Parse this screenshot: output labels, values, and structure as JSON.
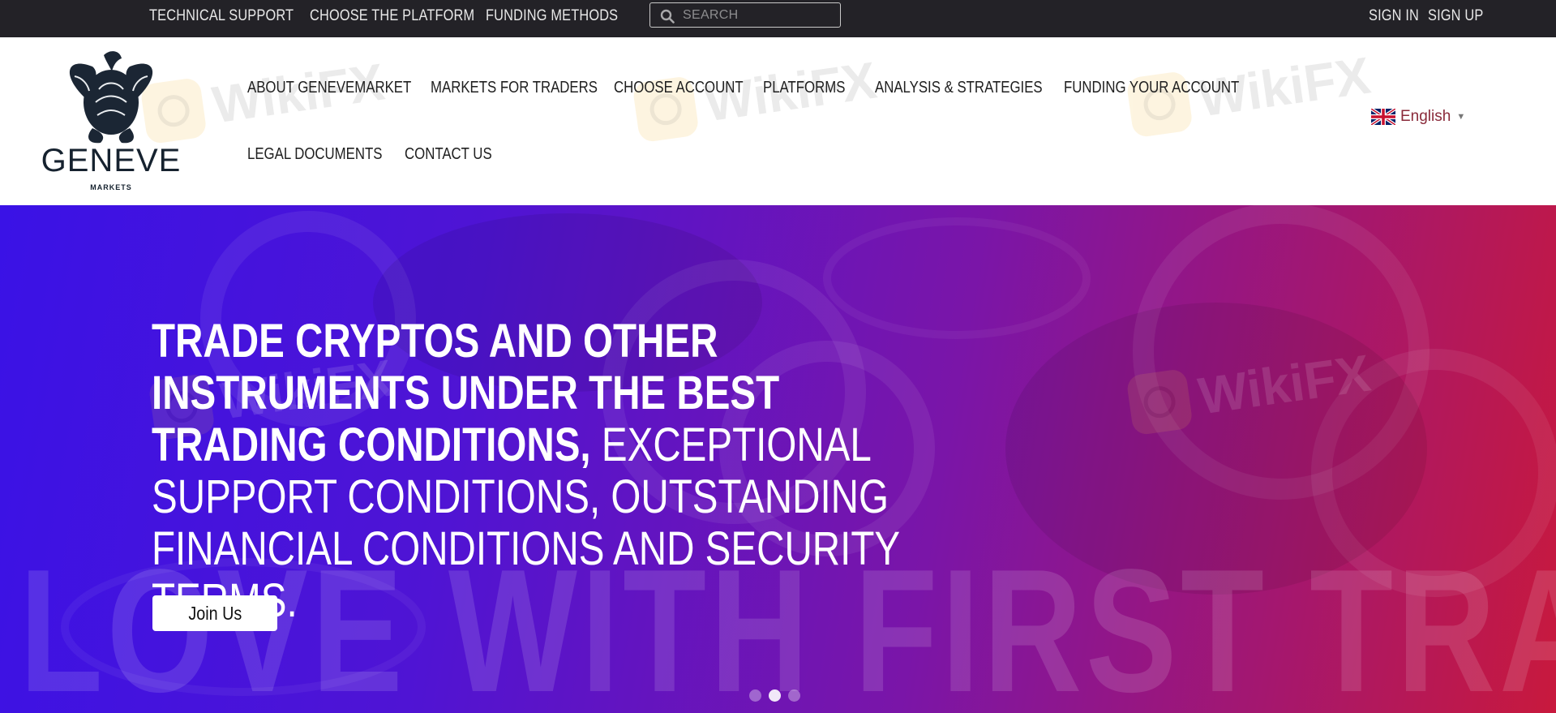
{
  "topbar": {
    "links": [
      "TECHNICAL SUPPORT",
      "CHOOSE THE PLATFORM",
      "FUNDING METHODS"
    ],
    "search_placeholder": "SEARCH",
    "sign_in": "SIGN IN",
    "sign_up": "SIGN UP"
  },
  "logo": {
    "name": "GENEVE",
    "sub": "MARKETS"
  },
  "nav": {
    "items": [
      "ABOUT GENEVEMARKET",
      "MARKETS FOR TRADERS",
      "CHOOSE ACCOUNT",
      "PLATFORMS",
      "ANALYSIS & STRATEGIES",
      "FUNDING YOUR ACCOUNT",
      "LEGAL DOCUMENTS",
      "CONTACT US"
    ]
  },
  "language": {
    "selected": "English",
    "flag": "uk-flag-icon"
  },
  "watermark": {
    "text": "WikiFX"
  },
  "hero": {
    "headline_bold": "TRADE CRYPTOS AND OTHER INSTRUMENTS UNDER THE BEST TRADING CONDITIONS,",
    "headline_light": "EXCEPTIONAL SUPPORT CONDITIONS, OUTSTANDING FINANCIAL CONDITIONS AND SECURITY TERMS.",
    "background_text": "LOVE WITH FIRST TRADE",
    "button_label": "Join Us",
    "slides_count": 3,
    "active_slide": 2
  },
  "colors": {
    "topbar_bg": "#232227",
    "hero_gradient_start": "#3a12e6",
    "hero_gradient_end": "#c8193d",
    "brand_dark": "#16222f"
  }
}
